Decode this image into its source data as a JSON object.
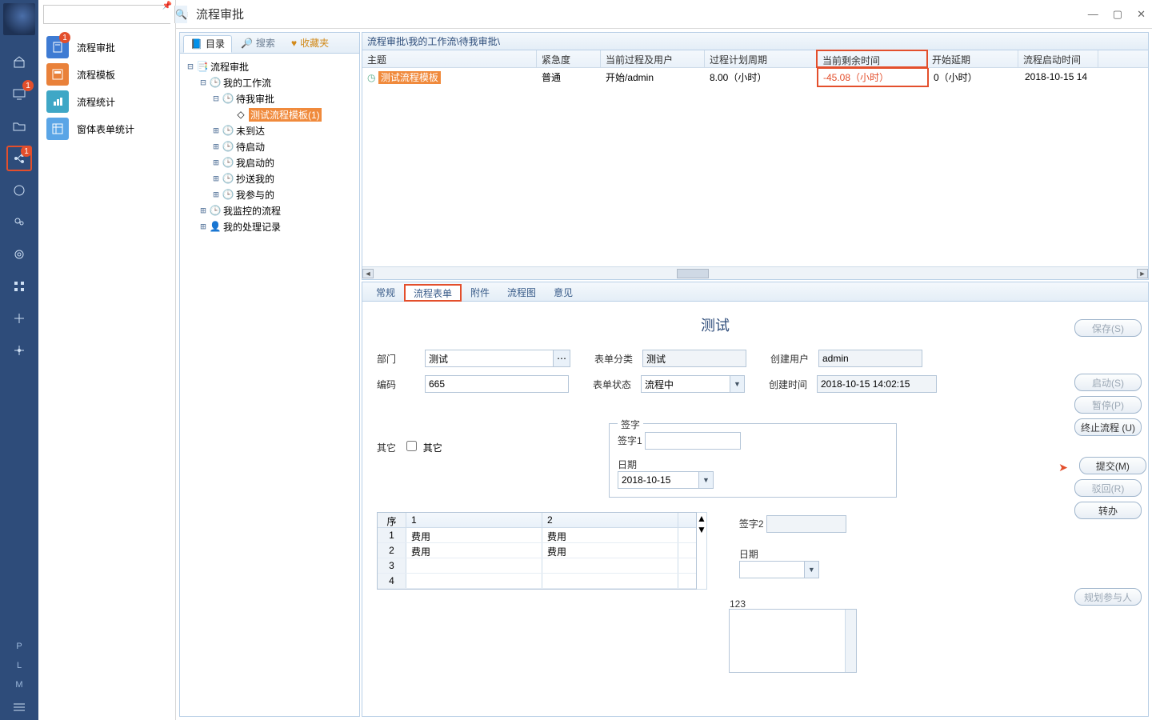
{
  "window": {
    "title": "流程审批"
  },
  "iconbar": {
    "badges": {
      "monitor": "1",
      "workflow": "1"
    },
    "letters": [
      "P",
      "L",
      "M"
    ]
  },
  "nav": {
    "search_placeholder": "",
    "items": [
      {
        "label": "流程审批",
        "badge": "1"
      },
      {
        "label": "流程模板"
      },
      {
        "label": "流程统计"
      },
      {
        "label": "窗体表单统计"
      }
    ]
  },
  "cat_tabs": {
    "directory": "目录",
    "search": "搜索",
    "favorites": "收藏夹"
  },
  "tree": {
    "root": "流程审批",
    "my_workflow": "我的工作流",
    "pending": "待我审批",
    "template_node": "测试流程模板(1)",
    "not_arrived": "未到达",
    "pending_start": "待启动",
    "started_by_me": "我启动的",
    "cc_me": "抄送我的",
    "participated": "我参与的",
    "monitored": "我监控的流程",
    "my_records": "我的处理记录"
  },
  "crumb": "流程审批\\我的工作流\\待我审批\\",
  "grid": {
    "cols": [
      "主题",
      "紧急度",
      "当前过程及用户",
      "过程计划周期",
      "当前剩余时间",
      "开始延期",
      "流程启动时间"
    ],
    "row": {
      "subject": "测试流程模板",
      "urgency": "普通",
      "current": "开始/admin",
      "plan": "8.00（小时）",
      "remain": "-45.08（小时）",
      "delay": "0（小时）",
      "start": "2018-10-15 14"
    }
  },
  "dtabs": [
    "常规",
    "流程表单",
    "附件",
    "流程图",
    "意见"
  ],
  "form": {
    "title": "测试",
    "dept_label": "部门",
    "dept_value": "测试",
    "cat_label": "表单分类",
    "cat_value": "测试",
    "creator_label": "创建用户",
    "creator_value": "admin",
    "code_label": "编码",
    "code_value": "665",
    "state_label": "表单状态",
    "state_value": "流程中",
    "ctime_label": "创建时间",
    "ctime_value": "2018-10-15 14:02:15",
    "other_label": "其它",
    "other_check": "其它",
    "sign_legend": "签字",
    "sign1_label": "签字1",
    "date_label": "日期",
    "date_value": "2018-10-15",
    "sign2_label": "签字2",
    "date2_label": "日期",
    "text_label": "123",
    "mini": {
      "head": [
        "序号",
        "1",
        "2"
      ],
      "rows": [
        [
          "1",
          "费用",
          "费用"
        ],
        [
          "2",
          "费用",
          "费用"
        ],
        [
          "3",
          "",
          ""
        ],
        [
          "4",
          "",
          ""
        ]
      ]
    }
  },
  "actions": {
    "save": "保存(S)",
    "start": "启动(S)",
    "pause": "暂停(P)",
    "terminate": "终止流程 (U)",
    "submit": "提交(M)",
    "reject": "驳回(R)",
    "transfer": "转办",
    "plan_people": "规划参与人"
  }
}
